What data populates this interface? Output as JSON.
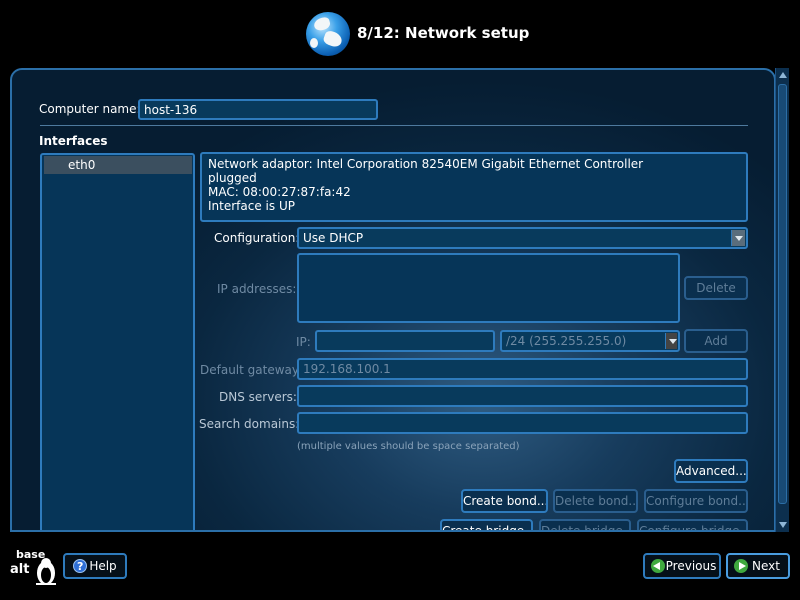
{
  "header": {
    "title": "8/12: Network setup",
    "icon": "globe-icon"
  },
  "computer_name": {
    "label": "Computer name:",
    "value": "host-136"
  },
  "interfaces": {
    "heading": "Interfaces",
    "items": [
      {
        "label": "eth0",
        "selected": true
      }
    ]
  },
  "adaptor_info": {
    "lines": [
      "Network adaptor: Intel Corporation 82540EM Gigabit Ethernet Controller",
      "plugged",
      "MAC: 08:00:27:87:fa:42",
      "Interface is UP"
    ]
  },
  "configuration": {
    "label": "Configuration:",
    "value": "Use DHCP"
  },
  "ip_addresses": {
    "label": "IP addresses:",
    "delete_label": "Delete"
  },
  "ip_entry": {
    "label": "IP:",
    "value": "",
    "mask_value": "/24 (255.255.255.0)",
    "add_label": "Add"
  },
  "gateway": {
    "label": "Default gateway:",
    "value": "192.168.100.1"
  },
  "dns": {
    "label": "DNS servers:",
    "value": ""
  },
  "search": {
    "label": "Search domains:",
    "value": ""
  },
  "hint": "(multiple values should be space separated)",
  "buttons": {
    "advanced": "Advanced...",
    "create_bond": "Create bond...",
    "delete_bond": "Delete bond...",
    "configure_bond": "Configure bond...",
    "create_bridge": "Create bridge...",
    "delete_bridge": "Delete bridge...",
    "configure_bridge": "Configure bridge..."
  },
  "footer": {
    "logo_line1": "base",
    "logo_line2": "alt",
    "help_label": "Help",
    "previous_label": "Previous",
    "next_label": "Next"
  },
  "colors": {
    "accent": "#2e7bbd",
    "panel": "#0a2740",
    "field": "#063558",
    "help_icon": "#2f6fd6",
    "nav_icon": "#3fa83f"
  }
}
